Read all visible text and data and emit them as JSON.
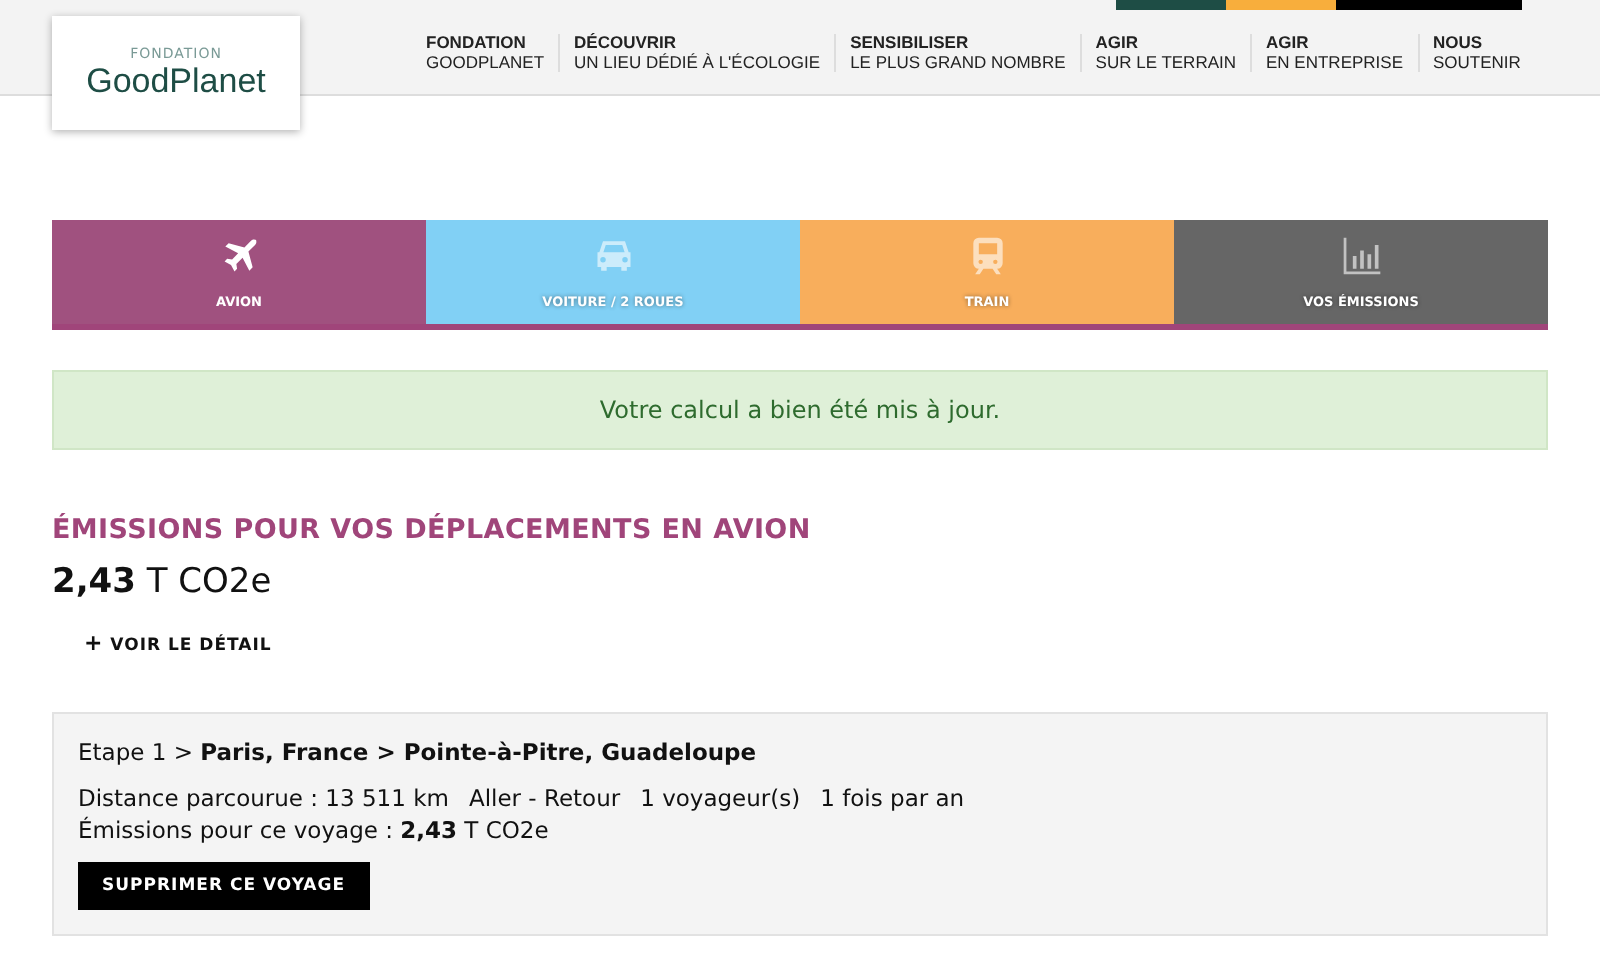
{
  "header": {
    "logo_top": "FONDATION",
    "logo_name": "GoodPlanet",
    "color_strip": [
      {
        "color": "#1e4d45"
      },
      {
        "color": "#f8ae3c"
      },
      {
        "color": "#000000"
      }
    ],
    "nav": [
      {
        "title": "FONDATION",
        "subtitle": "GOODPLANET"
      },
      {
        "title": "DÉCOUVRIR",
        "subtitle": "UN LIEU DÉDIÉ À L'ÉCOLOGIE"
      },
      {
        "title": "SENSIBILISER",
        "subtitle": "LE PLUS GRAND NOMBRE"
      },
      {
        "title": "AGIR",
        "subtitle": "SUR LE TERRAIN"
      },
      {
        "title": "AGIR",
        "subtitle": "EN ENTREPRISE"
      },
      {
        "title": "NOUS",
        "subtitle": "SOUTENIR"
      }
    ]
  },
  "tabs": [
    {
      "kind": "plane",
      "label": "AVION",
      "selected": true,
      "color": "#a0517f"
    },
    {
      "kind": "car",
      "label": "VOITURE / 2 ROUES",
      "selected": false,
      "color": "#81d0f5"
    },
    {
      "kind": "train",
      "label": "TRAIN",
      "selected": false,
      "color": "#f8ae5c"
    },
    {
      "kind": "chart",
      "label": "VOS ÉMISSIONS",
      "selected": false,
      "color": "#666666"
    }
  ],
  "alert": "Votre calcul a bien été mis à jour.",
  "heading": "ÉMISSIONS POUR VOS DÉPLACEMENTS EN AVION",
  "total": "**2,43** T CO2e",
  "detail_link": {
    "icon": "+",
    "label": "VOIR LE DÉTAIL"
  },
  "trip": {
    "title": "Etape 1 > **Paris, France > Pointe-à-Pitre, Guadeloupe**",
    "details": [
      "Distance parcourue : 13 511 km",
      "Aller - Retour",
      "1 voyageur(s)",
      "1 fois par an"
    ],
    "emissions": "Émissions pour ce voyage : **2,43** T CO2e",
    "delete_button": "SUPPRIMER CE VOYAGE"
  }
}
